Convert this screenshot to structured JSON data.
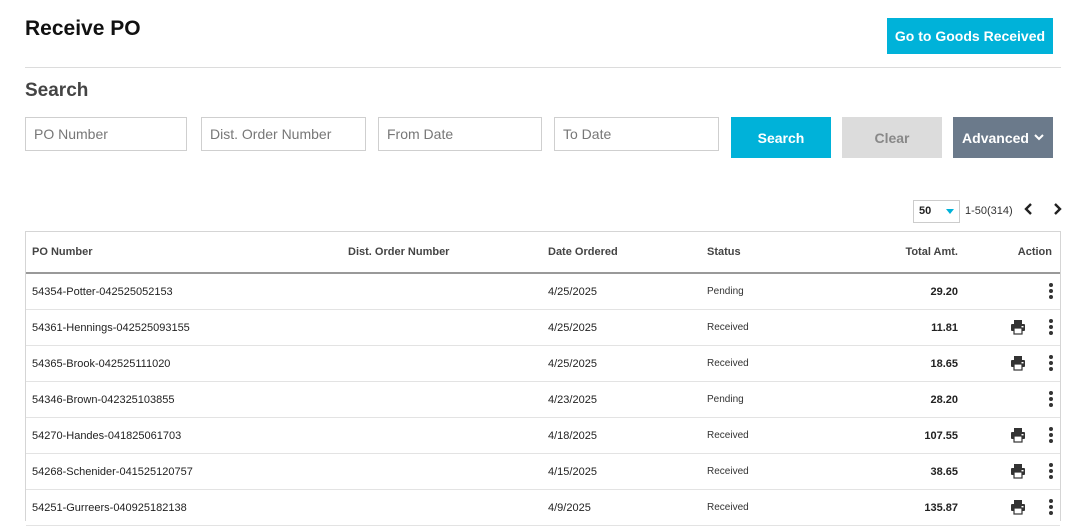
{
  "page": {
    "title": "Receive PO",
    "goods_button": "Go to Goods Received"
  },
  "search": {
    "title": "Search",
    "po_placeholder": "PO Number",
    "dist_placeholder": "Dist. Order Number",
    "from_placeholder": "From Date",
    "to_placeholder": "To Date",
    "search_label": "Search",
    "clear_label": "Clear",
    "advanced_label": "Advanced"
  },
  "pagination": {
    "page_size": "50",
    "range": "1-50(314)"
  },
  "table": {
    "headers": {
      "po": "PO Number",
      "dist": "Dist. Order Number",
      "date": "Date Ordered",
      "status": "Status",
      "total": "Total Amt.",
      "action": "Action"
    },
    "rows": [
      {
        "po": "54354-Potter-042525052153",
        "dist": "",
        "date": "4/25/2025",
        "status": "Pending",
        "total": "29.20"
      },
      {
        "po": "54361-Hennings-042525093155",
        "dist": "",
        "date": "4/25/2025",
        "status": "Received",
        "total": "11.81"
      },
      {
        "po": "54365-Brook-042525111020",
        "dist": "",
        "date": "4/25/2025",
        "status": "Received",
        "total": "18.65"
      },
      {
        "po": "54346-Brown-042325103855",
        "dist": "",
        "date": "4/23/2025",
        "status": "Pending",
        "total": "28.20"
      },
      {
        "po": "54270-Handes-041825061703",
        "dist": "",
        "date": "4/18/2025",
        "status": "Received",
        "total": "107.55"
      },
      {
        "po": "54268-Schenider-041525120757",
        "dist": "",
        "date": "4/15/2025",
        "status": "Received",
        "total": "38.65"
      },
      {
        "po": "54251-Gurreers-040925182138",
        "dist": "",
        "date": "4/9/2025",
        "status": "Received",
        "total": "135.87"
      }
    ]
  },
  "colors": {
    "accent": "#00b2d9",
    "advanced": "#6b7a8b",
    "clear": "#dcdcdc"
  },
  "icons": {
    "print": "print-icon",
    "more": "more-options-icon",
    "prev": "chevron-left-icon",
    "next": "chevron-right-icon",
    "dropdown": "chevron-down-icon"
  }
}
